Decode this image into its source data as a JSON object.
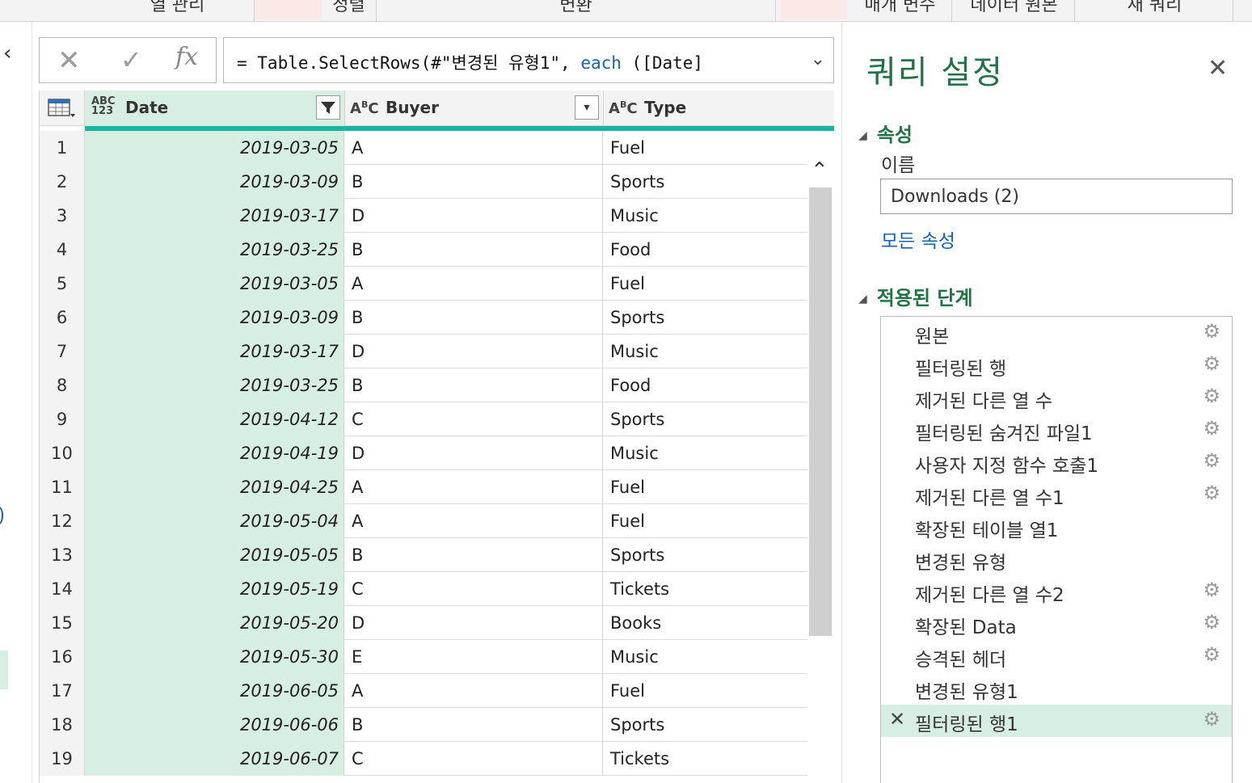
{
  "ribbon": {
    "groups": [
      "열 관리",
      "정렬",
      "변환",
      "매개 변수",
      "데이터 원본",
      "새 쿼리"
    ]
  },
  "formula_bar": {
    "cancel_icon": "close-icon",
    "commit_icon": "check-icon",
    "fx_label": "fx",
    "formula_prefix": "= Table.SelectRows(#\"변경된 유형1\", ",
    "formula_keyword": "each",
    "formula_suffix": " ([Date]"
  },
  "grid": {
    "columns": [
      {
        "name": "Date",
        "type_label": "ABC 123",
        "filtered": true
      },
      {
        "name": "Buyer",
        "type_label": "ABC"
      },
      {
        "name": "Type",
        "type_label": "ABC"
      }
    ],
    "rows": [
      {
        "n": "1",
        "date": "2019-03-05",
        "buyer": "A",
        "type": "Fuel"
      },
      {
        "n": "2",
        "date": "2019-03-09",
        "buyer": "B",
        "type": "Sports"
      },
      {
        "n": "3",
        "date": "2019-03-17",
        "buyer": "D",
        "type": "Music"
      },
      {
        "n": "4",
        "date": "2019-03-25",
        "buyer": "B",
        "type": "Food"
      },
      {
        "n": "5",
        "date": "2019-03-05",
        "buyer": "A",
        "type": "Fuel"
      },
      {
        "n": "6",
        "date": "2019-03-09",
        "buyer": "B",
        "type": "Sports"
      },
      {
        "n": "7",
        "date": "2019-03-17",
        "buyer": "D",
        "type": "Music"
      },
      {
        "n": "8",
        "date": "2019-03-25",
        "buyer": "B",
        "type": "Food"
      },
      {
        "n": "9",
        "date": "2019-04-12",
        "buyer": "C",
        "type": "Sports"
      },
      {
        "n": "10",
        "date": "2019-04-19",
        "buyer": "D",
        "type": "Music"
      },
      {
        "n": "11",
        "date": "2019-04-25",
        "buyer": "A",
        "type": "Fuel"
      },
      {
        "n": "12",
        "date": "2019-05-04",
        "buyer": "A",
        "type": "Fuel"
      },
      {
        "n": "13",
        "date": "2019-05-05",
        "buyer": "B",
        "type": "Sports"
      },
      {
        "n": "14",
        "date": "2019-05-19",
        "buyer": "C",
        "type": "Tickets"
      },
      {
        "n": "15",
        "date": "2019-05-20",
        "buyer": "D",
        "type": "Books"
      },
      {
        "n": "16",
        "date": "2019-05-30",
        "buyer": "E",
        "type": "Music"
      },
      {
        "n": "17",
        "date": "2019-06-05",
        "buyer": "A",
        "type": "Fuel"
      },
      {
        "n": "18",
        "date": "2019-06-06",
        "buyer": "B",
        "type": "Sports"
      },
      {
        "n": "19",
        "date": "2019-06-07",
        "buyer": "C",
        "type": "Tickets"
      }
    ]
  },
  "query_settings": {
    "title": "쿼리 설정",
    "properties_header": "속성",
    "name_label": "이름",
    "name_value": "Downloads (2)",
    "all_properties_link": "모든 속성",
    "applied_steps_header": "적용된 단계",
    "steps": [
      {
        "label": "원본",
        "gear": true,
        "selected": false
      },
      {
        "label": "필터링된 행",
        "gear": true,
        "selected": false
      },
      {
        "label": "제거된 다른 열 수",
        "gear": true,
        "selected": false
      },
      {
        "label": "필터링된 숨겨진 파일1",
        "gear": true,
        "selected": false
      },
      {
        "label": "사용자 지정 함수 호출1",
        "gear": true,
        "selected": false
      },
      {
        "label": "제거된 다른 열 수1",
        "gear": true,
        "selected": false
      },
      {
        "label": "확장된 테이블 열1",
        "gear": false,
        "selected": false
      },
      {
        "label": "변경된 유형",
        "gear": false,
        "selected": false
      },
      {
        "label": "제거된 다른 열 수2",
        "gear": true,
        "selected": false
      },
      {
        "label": "확장된 Data",
        "gear": true,
        "selected": false
      },
      {
        "label": "승격된 헤더",
        "gear": true,
        "selected": false
      },
      {
        "label": "변경된 유형1",
        "gear": false,
        "selected": false
      },
      {
        "label": "필터링된 행1",
        "gear": true,
        "selected": true
      }
    ]
  },
  "colors": {
    "accent_green": "#217346",
    "selected_column_bg": "#d7efe2",
    "column_quality_bar": "#19b5a4",
    "link_blue": "#1a5fb4"
  }
}
